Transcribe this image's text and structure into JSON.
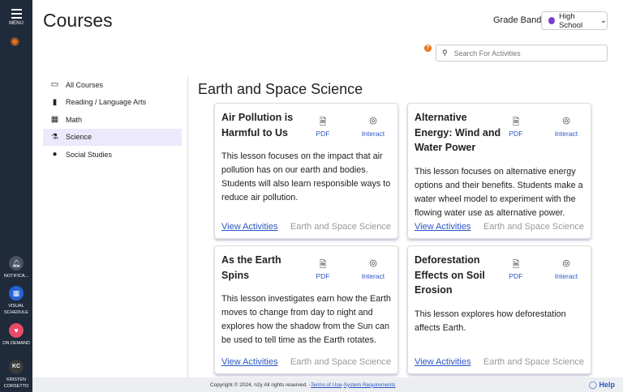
{
  "sidebar": {
    "menu": "MENU",
    "items": [
      {
        "label": "NOTIFICA...",
        "color": "#4a5262"
      },
      {
        "label": "VISUAL SCHEDULE",
        "color": "#2563d6"
      },
      {
        "label": "ON DEMAND",
        "color": "#e84a67"
      },
      {
        "label": "KRISTEN CORSETTO",
        "initials": "KC",
        "color": "#3a3a3a"
      }
    ]
  },
  "header": {
    "title": "Courses",
    "grade_band_label": "Grade Band",
    "grade_band_value": "High School",
    "help_badge": "?",
    "search_placeholder": "Search For Activities"
  },
  "nav": [
    {
      "label": "All Courses",
      "icon": "laptop-icon"
    },
    {
      "label": "Reading / Language Arts",
      "icon": "book-icon"
    },
    {
      "label": "Math",
      "icon": "calculator-icon"
    },
    {
      "label": "Science",
      "icon": "flask-icon",
      "selected": true
    },
    {
      "label": "Social Studies",
      "icon": "globe-icon"
    }
  ],
  "section_title": "Earth and Space Science",
  "pdf_label": "PDF",
  "interact_label": "Interact",
  "cards": [
    {
      "title": "Air Pollution is Harmful to Us",
      "desc": "This lesson focuses on the impact that air pollution has on our earth and bodies. Students will also learn responsible ways to reduce air pollution.",
      "link": "View Activities",
      "category": "Earth and Space Science"
    },
    {
      "title": "Alternative Energy: Wind and Water Power",
      "desc": "This lesson focuses on alternative energy options and their benefits. Students make a water wheel model to experiment with the flowing water use as alternative power.",
      "link": "View Activities",
      "category": "Earth and Space Science"
    },
    {
      "title": "As the Earth Spins",
      "desc": "This lesson investigates earn how the Earth moves to change from day to night and explores how the shadow from the Sun can be used to tell time as the Earth rotates.",
      "link": "View Activities",
      "category": "Earth and Space Science"
    },
    {
      "title": "Deforestation Effects on Soil Erosion",
      "desc": "This lesson explores how deforestation affects Earth.",
      "link": "View Activities",
      "category": "Earth and Space Science"
    }
  ],
  "footer": {
    "copyright": "Copyright © 2024, n2y All rights reserved. - ",
    "terms": "Terms of Use",
    "sep": " - ",
    "sysreq": "System Requirements",
    "help": "Help"
  }
}
